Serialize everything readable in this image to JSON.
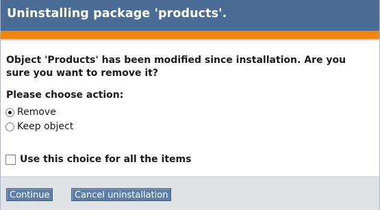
{
  "dialog": {
    "title": "Uninstalling package 'products'.",
    "message": "Object 'Products' has been modified since installation. Are you sure you want to remove it?",
    "prompt": "Please choose action:",
    "options": [
      {
        "label": "Remove",
        "selected": true
      },
      {
        "label": "Keep object",
        "selected": false
      }
    ],
    "apply_all": {
      "label": "Use this choice for all the items",
      "checked": false
    },
    "buttons": {
      "continue": "Continue",
      "cancel": "Cancel uninstallation"
    }
  },
  "colors": {
    "title_bar": "#4b6d95",
    "accent": "#f0850f",
    "button": "#5c7ea8",
    "footer": "#dfe3e8"
  }
}
